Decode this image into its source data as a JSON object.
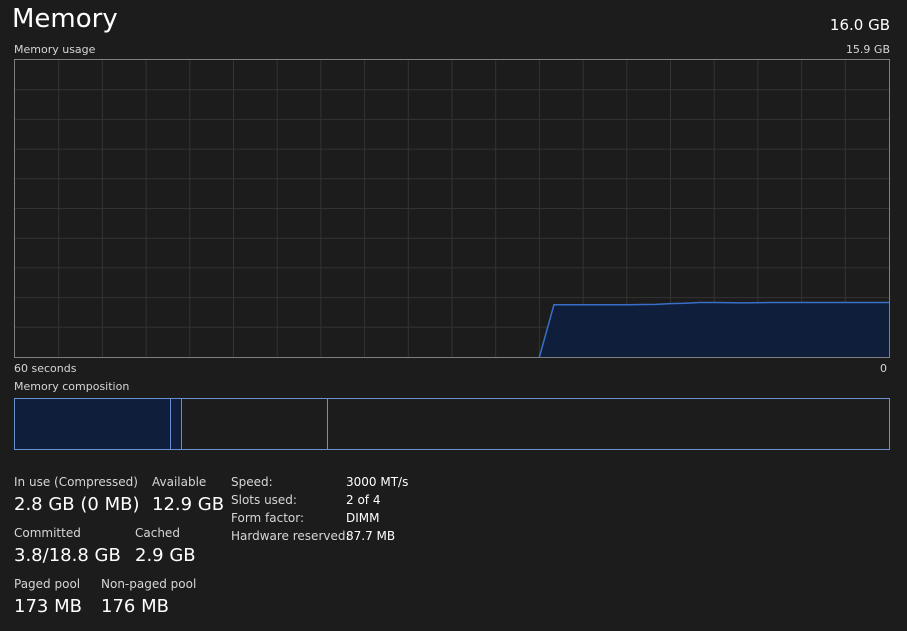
{
  "header": {
    "title": "Memory",
    "total": "16.0 GB"
  },
  "graph": {
    "label": "Memory usage",
    "max_label": "15.9 GB",
    "x_left_label": "60 seconds",
    "x_right_label": "0"
  },
  "chart_data": {
    "type": "area",
    "title": "Memory usage",
    "xlabel": "",
    "ylabel": "",
    "x_range_seconds": [
      60,
      0
    ],
    "ylim_gb": [
      0,
      15.9
    ],
    "grid": true,
    "line_color": "#3a6fc8",
    "fill_color": "#0f1e3a",
    "x": [
      24,
      23,
      18,
      16,
      15,
      14,
      13,
      12,
      10,
      8,
      6,
      4,
      2,
      0
    ],
    "values_gb": [
      0.0,
      2.8,
      2.8,
      2.82,
      2.86,
      2.88,
      2.92,
      2.92,
      2.9,
      2.92,
      2.92,
      2.92,
      2.92,
      2.92
    ]
  },
  "composition": {
    "label": "Memory composition"
  },
  "stats": {
    "in_use_label": "In use (Compressed)",
    "in_use_value": "2.8 GB (0 MB)",
    "available_label": "Available",
    "available_value": "12.9 GB",
    "committed_label": "Committed",
    "committed_value": "3.8/18.8 GB",
    "cached_label": "Cached",
    "cached_value": "2.9 GB",
    "paged_pool_label": "Paged pool",
    "paged_pool_value": "173 MB",
    "non_paged_pool_label": "Non-paged pool",
    "non_paged_pool_value": "176 MB"
  },
  "specs": {
    "speed_label": "Speed:",
    "speed_value": "3000 MT/s",
    "slots_label": "Slots used:",
    "slots_value": "2 of 4",
    "form_factor_label": "Form factor:",
    "form_factor_value": "DIMM",
    "hw_reserved_label": "Hardware reserved:",
    "hw_reserved_value": "87.7 MB"
  }
}
